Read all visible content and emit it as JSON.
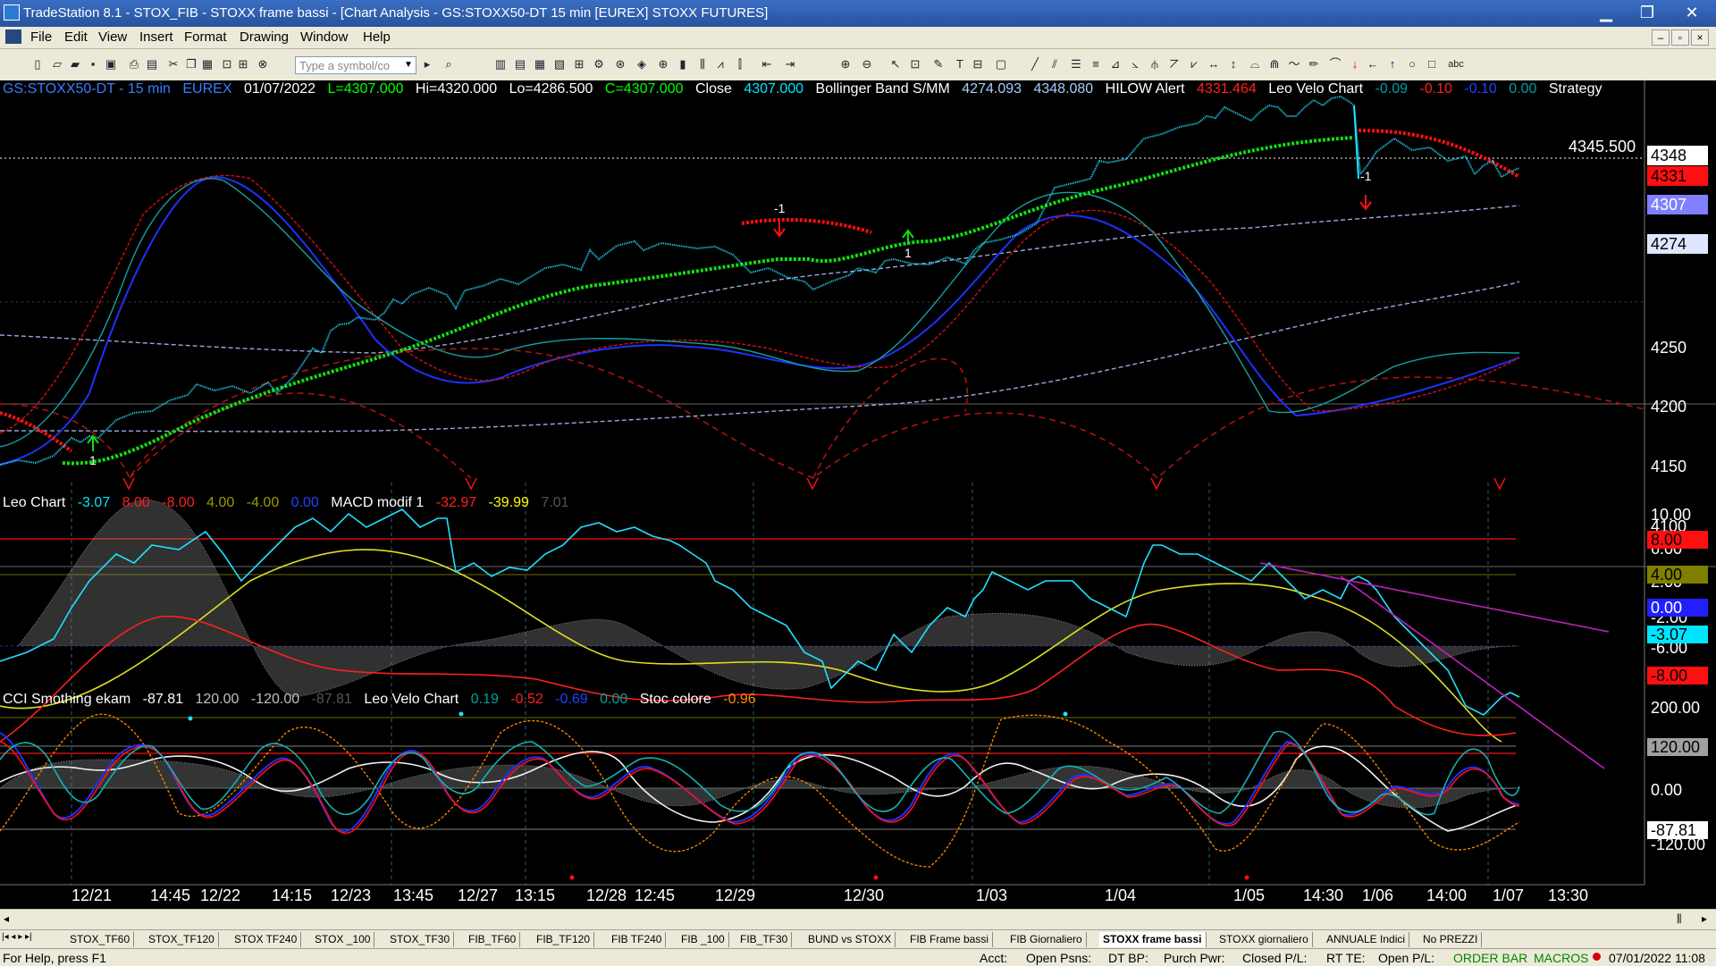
{
  "window": {
    "title": "TradeStation 8.1 - STOX_FIB - STOXX frame bassi - [Chart Analysis - GS:STOXX50-DT  15 min  [EUREX] STOXX FUTURES]",
    "minimize": "▁",
    "maximize": "❐",
    "close": "✕"
  },
  "menu": [
    "File",
    "Edit",
    "View",
    "Insert",
    "Format",
    "Drawing",
    "Window",
    "Help"
  ],
  "mdi_buttons": [
    "–",
    "▫",
    "×"
  ],
  "toolbar": {
    "symbol_placeholder": "Type a symbol/co",
    "text_tool": "abc"
  },
  "chart": {
    "header": [
      {
        "text": "GS:STOXX50-DT - 15 min",
        "color": "#3a7bff"
      },
      {
        "text": "EUREX",
        "color": "#3a7bff"
      },
      {
        "text": "01/07/2022",
        "color": "#ffffff"
      },
      {
        "text": "L=4307.000",
        "color": "#00ff00"
      },
      {
        "text": "Hi=4320.000",
        "color": "#ffffff"
      },
      {
        "text": "Lo=4286.500",
        "color": "#ffffff"
      },
      {
        "text": "C=4307.000",
        "color": "#00ff00"
      },
      {
        "text": "Close",
        "color": "#ffffff"
      },
      {
        "text": "4307.000",
        "color": "#00e5ff"
      },
      {
        "text": "Bollinger Band S/MM",
        "color": "#ffffff"
      },
      {
        "text": "4274.093",
        "color": "#aaccff"
      },
      {
        "text": "4348.080",
        "color": "#aaccff"
      },
      {
        "text": "HILOW Alert",
        "color": "#ffffff"
      },
      {
        "text": "4331.464",
        "color": "#ff2020"
      },
      {
        "text": "Leo Velo Chart",
        "color": "#ffffff"
      },
      {
        "text": "-0.09",
        "color": "#00a0a0"
      },
      {
        "text": "-0.10",
        "color": "#ff2020"
      },
      {
        "text": "-0.10",
        "color": "#2040ff"
      },
      {
        "text": "0.00",
        "color": "#00a0a0"
      },
      {
        "text": "Strategy",
        "color": "#ffffff"
      }
    ],
    "hline_label": "4345.500",
    "price_axis": [
      "4250",
      "4200",
      "4150",
      "4100"
    ],
    "price_markers": [
      {
        "text": "4348",
        "bg": "#ffffff",
        "fg": "#000000"
      },
      {
        "text": "4331",
        "bg": "#ff1010",
        "fg": "#000000"
      },
      {
        "text": "4307",
        "bg": "#7f7fff",
        "fg": "#ffffff"
      },
      {
        "text": "4274",
        "bg": "#dde8ff",
        "fg": "#000000"
      }
    ],
    "signals": {
      "top1": "-1",
      "top2": "1",
      "top3": "-1",
      "bottom1": "1"
    }
  },
  "panel2": {
    "legend": [
      {
        "text": "Leo Chart",
        "color": "#ffffff"
      },
      {
        "text": "-3.07",
        "color": "#00e5ff"
      },
      {
        "text": "8.00",
        "color": "#ff2020"
      },
      {
        "text": "-8.00",
        "color": "#ff2020"
      },
      {
        "text": "4.00",
        "color": "#9a9a00"
      },
      {
        "text": "-4.00",
        "color": "#9a9a00"
      },
      {
        "text": "0.00",
        "color": "#2040ff"
      },
      {
        "text": "MACD modif 1",
        "color": "#ffffff"
      },
      {
        "text": "-32.97",
        "color": "#ff2020"
      },
      {
        "text": "-39.99",
        "color": "#ffff00"
      },
      {
        "text": "7.01",
        "color": "#555555"
      }
    ],
    "axis": [
      "10.00",
      "6.00",
      "2.00",
      "-2.00",
      "-6.00"
    ],
    "markers": [
      {
        "text": "8.00",
        "bg": "#ff1010",
        "fg": "#000000"
      },
      {
        "text": "4.00",
        "bg": "#808000",
        "fg": "#000000"
      },
      {
        "text": "0.00",
        "bg": "#2020ff",
        "fg": "#ffffff"
      },
      {
        "text": "-3.07",
        "bg": "#00e5ff",
        "fg": "#000000"
      },
      {
        "text": "-8.00",
        "bg": "#ff1010",
        "fg": "#000000"
      }
    ]
  },
  "panel3": {
    "legend": [
      {
        "text": "CCI Smothing ekam",
        "color": "#ffffff"
      },
      {
        "text": "-87.81",
        "color": "#ffffff"
      },
      {
        "text": "120.00",
        "color": "#c0c0c0"
      },
      {
        "text": "-120.00",
        "color": "#c0c0c0"
      },
      {
        "text": "-87.81",
        "color": "#555555"
      },
      {
        "text": "Leo Velo Chart",
        "color": "#ffffff"
      },
      {
        "text": "0.19",
        "color": "#00a0a0"
      },
      {
        "text": "-0.52",
        "color": "#ff2020"
      },
      {
        "text": "-0.69",
        "color": "#2040ff"
      },
      {
        "text": "0.00",
        "color": "#00a0a0"
      },
      {
        "text": "Stoc colore",
        "color": "#ffffff"
      },
      {
        "text": "-0.96",
        "color": "#ff8c00"
      }
    ],
    "axis": [
      "200.00",
      "0.00",
      "-120.00"
    ],
    "markers": [
      {
        "text": "120.00",
        "bg": "#a0a0a0",
        "fg": "#000000"
      },
      {
        "text": "-87.81",
        "bg": "#ffffff",
        "fg": "#000000"
      }
    ]
  },
  "time_axis": [
    "12/21",
    "14:45",
    "12/22",
    "14:15",
    "12/23",
    "13:45",
    "12/27",
    "13:15",
    "12/28",
    "12:45",
    "12/29",
    "12/30",
    "1/03",
    "1/04",
    "1/05",
    "14:30",
    "1/06",
    "14:00",
    "1/07",
    "13:30"
  ],
  "tabs": [
    "STOX_TF60",
    "STOX_TF120",
    "STOX TF240",
    "STOX _100",
    "STOX_TF30",
    "FIB_TF60",
    "FIB_TF120",
    "FIB TF240",
    "FIB _100",
    "FIB_TF30",
    "BUND vs STOXX",
    "FIB Frame bassi",
    "FIB Giornaliero",
    "STOXX frame bassi",
    "STOXX giornaliero",
    "ANNUALE Indici",
    "No PREZZI"
  ],
  "status": {
    "help": "For Help, press F1",
    "acct": "Acct:",
    "open_psns": "Open Psns:",
    "dt_bp": "DT BP:",
    "purch_pwr": "Purch Pwr:",
    "closed_pl": "Closed P/L:",
    "rt_te": "RT TE:",
    "open_pl": "Open P/L:",
    "order_bar": "ORDER BAR",
    "macros": "MACROS",
    "datetime": "07/01/2022 11:08"
  }
}
